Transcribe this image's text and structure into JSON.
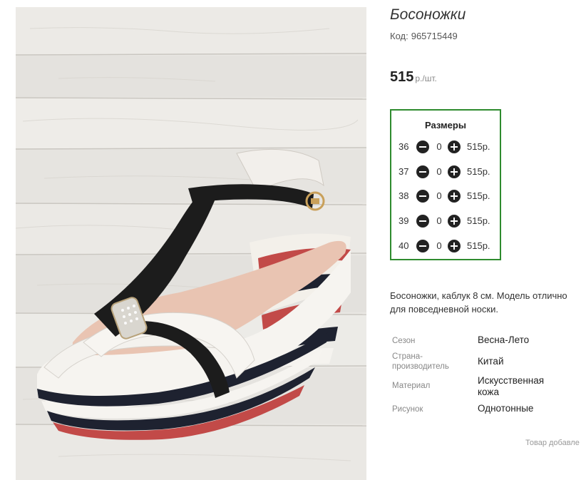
{
  "product": {
    "title": "Босоножки",
    "code_label": "Код:",
    "code_value": "965715449",
    "price_value": "515",
    "price_unit": "р./шт."
  },
  "sizes": {
    "title": "Размеры",
    "rows": [
      {
        "size": "36",
        "qty": "0",
        "price": "515р."
      },
      {
        "size": "37",
        "qty": "0",
        "price": "515р."
      },
      {
        "size": "38",
        "qty": "0",
        "price": "515р."
      },
      {
        "size": "39",
        "qty": "0",
        "price": "515р."
      },
      {
        "size": "40",
        "qty": "0",
        "price": "515р."
      }
    ]
  },
  "description": {
    "line1": "Босоножки, каблук 8 см. Модель отлично",
    "line2": "для повседневной носки."
  },
  "attributes": {
    "season_label": "Сезон",
    "season_value": "Весна-Лето",
    "country_label_1": "Страна-",
    "country_label_2": "производитель",
    "country_value": "Китай",
    "material_label": "Материал",
    "material_value_1": "Искусственная",
    "material_value_2": "кожа",
    "pattern_label": "Рисунок",
    "pattern_value": "Однотонные"
  },
  "footer": {
    "added_text": "Товар добавле"
  },
  "colors": {
    "size_box_border": "#2e8b2e",
    "wood_background": "#e9e7e3",
    "strap_black": "#1c1c1c",
    "strap_white": "#f4f2ee",
    "wedge_red": "#c24a48",
    "wedge_navy": "#1e2230"
  },
  "icons": {
    "decrease": "minus-circle-icon",
    "increase": "plus-circle-icon"
  }
}
